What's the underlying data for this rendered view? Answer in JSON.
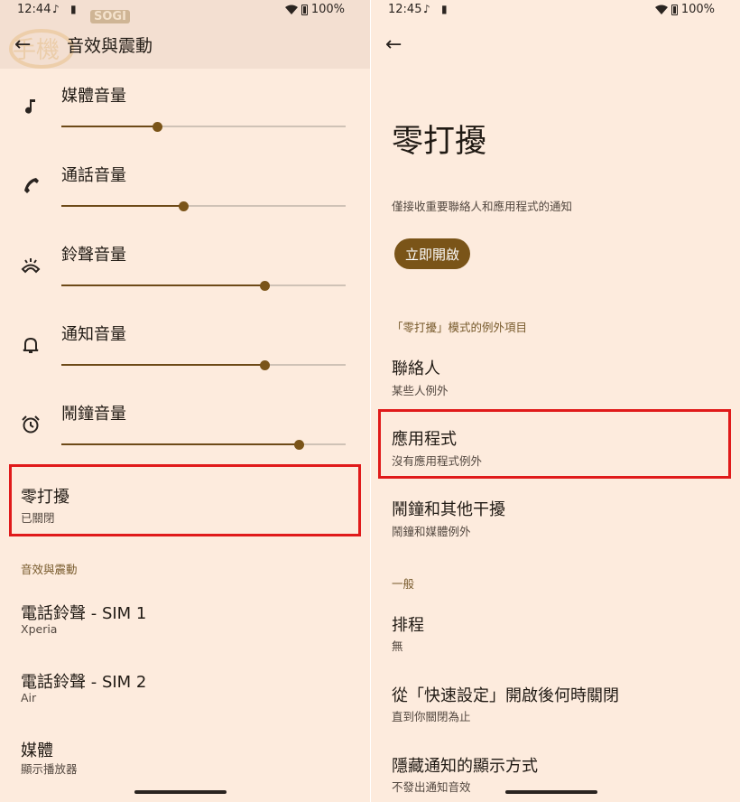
{
  "left": {
    "status": {
      "time": "12:44",
      "battery": "100%"
    },
    "title": "音效與震動",
    "watermark_text": "SOGI",
    "volumes": [
      {
        "icon": "music-note-icon",
        "label": "媒體音量",
        "level": 0.335
      },
      {
        "icon": "phone-icon",
        "label": "通話音量",
        "level": 0.43
      },
      {
        "icon": "ringer-icon",
        "label": "鈴聲音量",
        "level": 0.715
      },
      {
        "icon": "bell-icon",
        "label": "通知音量",
        "level": 0.715
      },
      {
        "icon": "alarm-clock-icon",
        "label": "鬧鐘音量",
        "level": 0.835
      }
    ],
    "dnd": {
      "title": "零打擾",
      "subtitle": "已關閉"
    },
    "section_header": "音效與震動",
    "items": [
      {
        "title": "電話鈴聲 - SIM 1",
        "subtitle": "Xperia"
      },
      {
        "title": "電話鈴聲 - SIM 2",
        "subtitle": "Air"
      },
      {
        "title": "媒體",
        "subtitle": "顯示播放器"
      }
    ]
  },
  "right": {
    "status": {
      "time": "12:45",
      "battery": "100%"
    },
    "title": "零打擾",
    "description": "僅接收重要聯絡人和應用程式的通知",
    "turn_on_label": "立即開啟",
    "exceptions_header": "「零打擾」模式的例外項目",
    "exceptions": [
      {
        "title": "聯絡人",
        "subtitle": "某些人例外"
      },
      {
        "title": "應用程式",
        "subtitle": "沒有應用程式例外"
      },
      {
        "title": "鬧鐘和其他干擾",
        "subtitle": "鬧鐘和媒體例外"
      }
    ],
    "general_header": "一般",
    "general": [
      {
        "title": "排程",
        "subtitle": "無"
      },
      {
        "title": "從「快速設定」開啟後何時關閉",
        "subtitle": "直到你關閉為止"
      },
      {
        "title": "隱藏通知的顯示方式",
        "subtitle": "不發出通知音效"
      }
    ]
  },
  "colors": {
    "background": "#fdebdd",
    "accent": "#7a5418",
    "highlight": "#e01a1a"
  }
}
